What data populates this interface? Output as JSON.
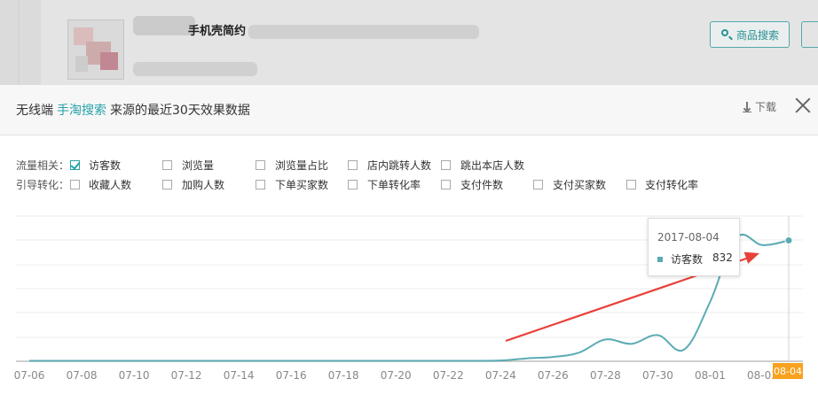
{
  "header": {
    "shop_title": "手机壳简约",
    "search_button": "商品搜索"
  },
  "modal": {
    "title_prefix": "无线端",
    "title_source": "手淘搜索",
    "title_suffix": "来源的最近30天效果数据",
    "download_label": "下载"
  },
  "filters": {
    "traffic": {
      "label": "流量相关：",
      "items": [
        {
          "label": "访客数",
          "checked": true
        },
        {
          "label": "浏览量",
          "checked": false
        },
        {
          "label": "浏览量占比",
          "checked": false
        },
        {
          "label": "店内跳转人数",
          "checked": false
        },
        {
          "label": "跳出本店人数",
          "checked": false
        }
      ]
    },
    "conversion": {
      "label": "引导转化：",
      "items": [
        {
          "label": "收藏人数",
          "checked": false
        },
        {
          "label": "加购人数",
          "checked": false
        },
        {
          "label": "下单买家数",
          "checked": false
        },
        {
          "label": "下单转化率",
          "checked": false
        },
        {
          "label": "支付件数",
          "checked": false
        },
        {
          "label": "支付买家数",
          "checked": false
        },
        {
          "label": "支付转化率",
          "checked": false
        }
      ]
    }
  },
  "tooltip": {
    "date": "2017-08-04",
    "series_name": "访客数",
    "value": "832"
  },
  "x_highlight": "08-04",
  "colors": {
    "accent": "#27a2a8",
    "line": "#5aabb3",
    "arrow": "#e8413a",
    "highlight": "#f8a21f"
  },
  "chart_data": {
    "type": "line",
    "x": [
      "07-06",
      "07-07",
      "07-08",
      "07-09",
      "07-10",
      "07-11",
      "07-12",
      "07-13",
      "07-14",
      "07-15",
      "07-16",
      "07-17",
      "07-18",
      "07-19",
      "07-20",
      "07-21",
      "07-22",
      "07-23",
      "07-24",
      "07-25",
      "07-26",
      "07-27",
      "07-28",
      "07-29",
      "07-30",
      "07-31",
      "08-01",
      "08-02",
      "08-03",
      "08-04"
    ],
    "tick_labels": [
      "07-06",
      "07-08",
      "07-10",
      "07-12",
      "07-14",
      "07-16",
      "07-18",
      "07-20",
      "07-22",
      "07-24",
      "07-26",
      "07-28",
      "07-30",
      "08-01",
      "08-03"
    ],
    "series": [
      {
        "name": "访客数",
        "values": [
          3,
          3,
          3,
          3,
          3,
          3,
          3,
          3,
          3,
          3,
          3,
          3,
          3,
          3,
          3,
          3,
          3,
          3,
          5,
          20,
          30,
          60,
          150,
          120,
          180,
          80,
          410,
          850,
          800,
          832
        ]
      }
    ],
    "ylim": [
      0,
      1000
    ],
    "grid": true
  }
}
